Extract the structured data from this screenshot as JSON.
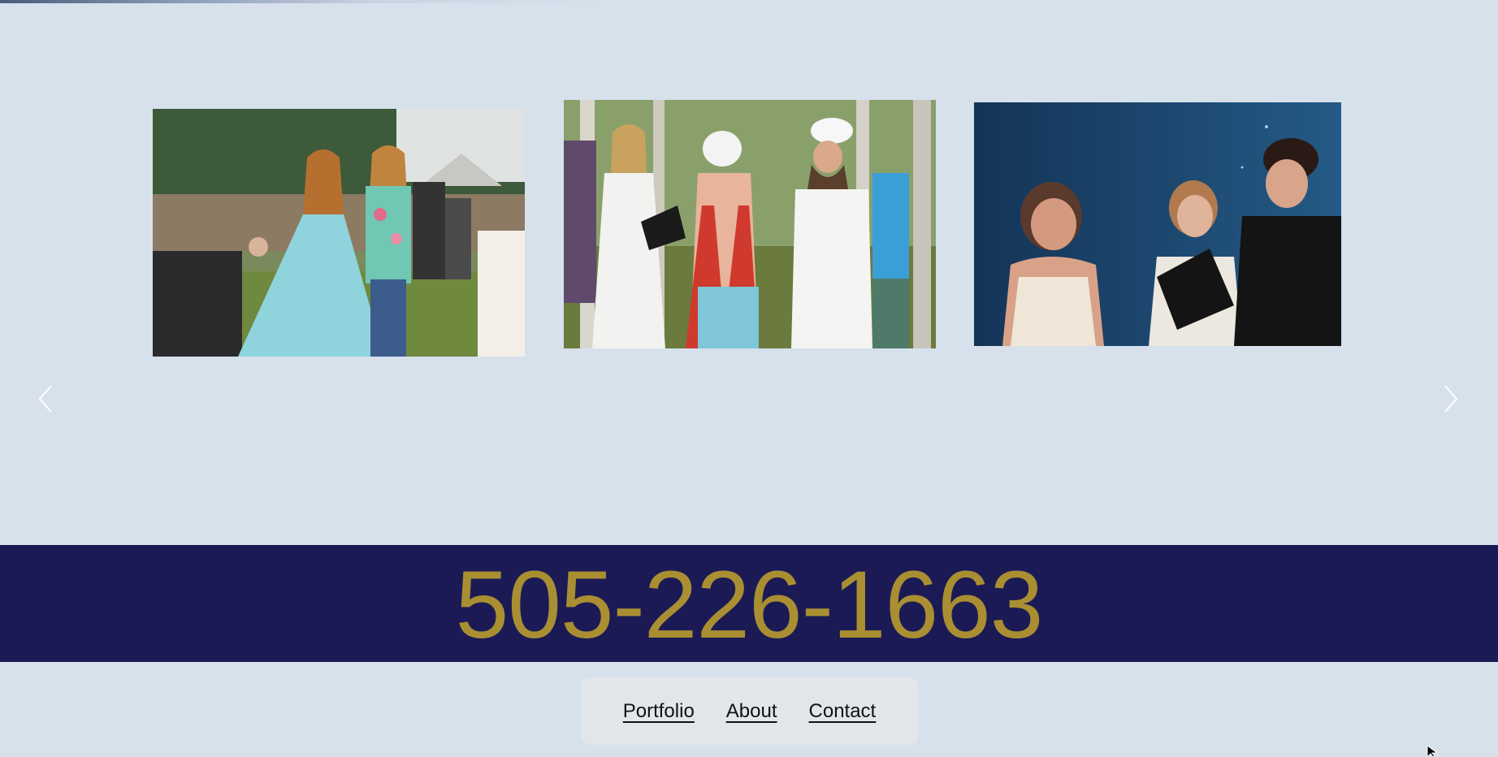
{
  "gallery": {
    "prev_icon": "chevron-left-icon",
    "next_icon": "chevron-right-icon",
    "slides": [
      {
        "description_icon": "photo-couple-walking-aisle"
      },
      {
        "description_icon": "photo-outdoor-ceremony"
      },
      {
        "description_icon": "photo-officiant-laughing"
      }
    ]
  },
  "contact": {
    "phone": "505-226-1663",
    "band_color": "#1c1a55",
    "phone_color": "#a98f32"
  },
  "nav": {
    "items": [
      {
        "label": "Portfolio"
      },
      {
        "label": "About"
      },
      {
        "label": "Contact"
      }
    ]
  },
  "colors": {
    "page_bg": "#d6e1ec",
    "nav_bg": "#e2e6ea"
  }
}
